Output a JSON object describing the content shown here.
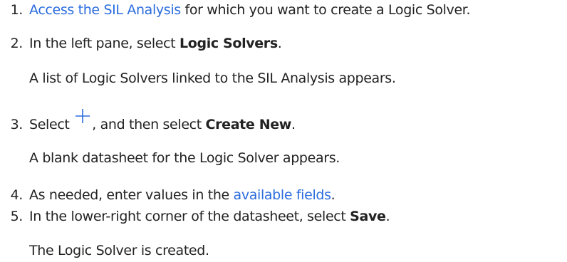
{
  "steps": [
    {
      "number": "1.",
      "link_text": "Access the SIL Analysis",
      "rest_text": " for which you want to create a Logic Solver."
    },
    {
      "number": "2.",
      "pre_text": "In the left pane, select ",
      "bold_text": "Logic Solvers",
      "post_text": ".",
      "result": "A list of Logic Solvers linked to the SIL Analysis appears."
    },
    {
      "number": "3.",
      "pre_text": "Select ",
      "icon": "plus-icon",
      "mid_text": ", and then select ",
      "bold_text": "Create New",
      "post_text": ".",
      "result": "A blank datasheet for the Logic Solver appears."
    },
    {
      "number": "4.",
      "pre_text": "As needed, enter values in the ",
      "link_text": "available fields",
      "post_text": "."
    },
    {
      "number": "5.",
      "pre_text": "In the lower-right corner of the datasheet, select ",
      "bold_text": "Save",
      "post_text": ".",
      "result": "The Logic Solver is created."
    }
  ],
  "colors": {
    "link": "#2b6cde",
    "text": "#222222",
    "icon": "#2b6cde"
  }
}
